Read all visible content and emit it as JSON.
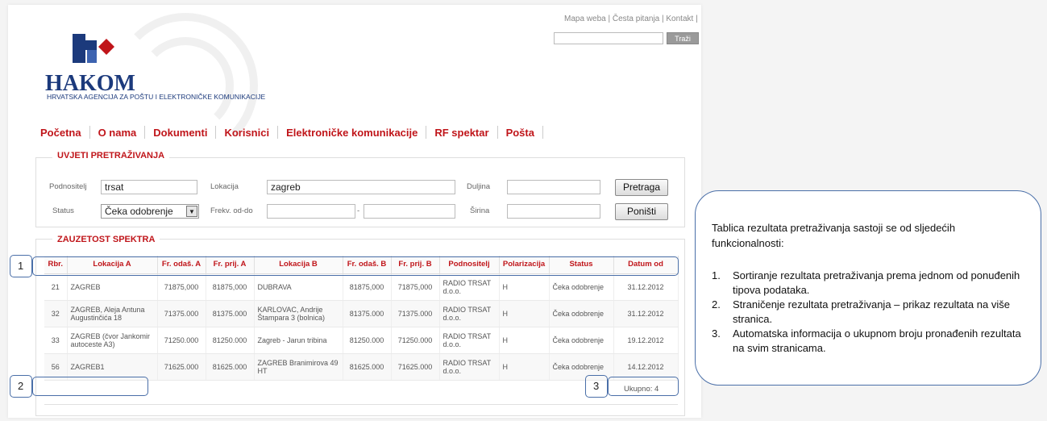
{
  "header": {
    "toplinks": [
      "Mapa weba",
      "Česta pitanja",
      "Kontakt"
    ],
    "search_button": "Traži",
    "logo_text": "HAKOM",
    "logo_subtitle": "HRVATSKA AGENCIJA ZA POŠTU I ELEKTRONIČKE KOMUNIKACIJE"
  },
  "nav": [
    "Početna",
    "O nama",
    "Dokumenti",
    "Korisnici",
    "Elektroničke komunikacije",
    "RF spektar",
    "Pošta"
  ],
  "search_panel": {
    "title": "UVJETI PRETRAŽIVANJA",
    "podnositelj_label": "Podnositelj",
    "podnositelj_value": "trsat",
    "lokacija_label": "Lokacija",
    "lokacija_value": "zagreb",
    "duljina_label": "Duljina",
    "duljina_value": "",
    "status_label": "Status",
    "status_value": "Čeka odobrenje",
    "frekv_label": "Frekv. od-do",
    "frekv_from": "",
    "frekv_dash": "-",
    "frekv_to": "",
    "sirina_label": "Širina",
    "sirina_value": "",
    "search_button": "Pretraga",
    "reset_button": "Poništi"
  },
  "results": {
    "title": "ZAUZETOST SPEKTRA",
    "columns": [
      "Rbr.",
      "Lokacija A",
      "Fr. odaš. A",
      "Fr. prij. A",
      "Lokacija B",
      "Fr. odaš. B",
      "Fr. prij. B",
      "Podnositelj",
      "Polarizacija",
      "Status",
      "Datum od"
    ],
    "rows": [
      [
        "21",
        "ZAGREB",
        "71875,000",
        "81875,000",
        "DUBRAVA",
        "81875,000",
        "71875,000",
        "RADIO TRSAT d.o.o.",
        "H",
        "Čeka odobrenje",
        "31.12.2012"
      ],
      [
        "32",
        "ZAGREB, Aleja Antuna Augustinčića 18",
        "71375.000",
        "81375.000",
        "KARLOVAC, Andrije Štampara 3 (bolnica)",
        "81375.000",
        "71375.000",
        "RADIO TRSAT d.o.o.",
        "H",
        "Čeka odobrenje",
        "31.12.2012"
      ],
      [
        "33",
        "ZAGREB (čvor Jankomir autoceste A3)",
        "71250.000",
        "81250.000",
        "Zagreb - Jarun tribina",
        "81250.000",
        "71250.000",
        "RADIO TRSAT d.o.o.",
        "H",
        "Čeka odobrenje",
        "19.12.2012"
      ],
      [
        "56",
        "ZAGREB1",
        "71625.000",
        "81625.000",
        "ZAGREB Branimirova 49 HT",
        "81625.000",
        "71625.000",
        "RADIO TRSAT d.o.o.",
        "H",
        "Čeka odobrenje",
        "14.12.2012"
      ]
    ],
    "total": "Ukupno: 4"
  },
  "callouts": [
    "1",
    "2",
    "3"
  ],
  "info": {
    "intro": "Tablica rezultata pretraživanja sastoji se od sljedećih funkcionalnosti:",
    "items": [
      "Sortiranje rezultata pretraživanja prema jednom od ponuđenih tipova podataka.",
      "Straničenje rezultata pretraživanja – prikaz rezultata na više stranica.",
      "Automatska informacija o ukupnom broju pronađenih rezultata na svim stranicama."
    ],
    "numbers": [
      "1.",
      "2.",
      "3."
    ]
  },
  "colors": {
    "brand_red": "#c0151a",
    "brand_blue": "#1c3a7c",
    "callout_blue": "#4a6fa8"
  }
}
